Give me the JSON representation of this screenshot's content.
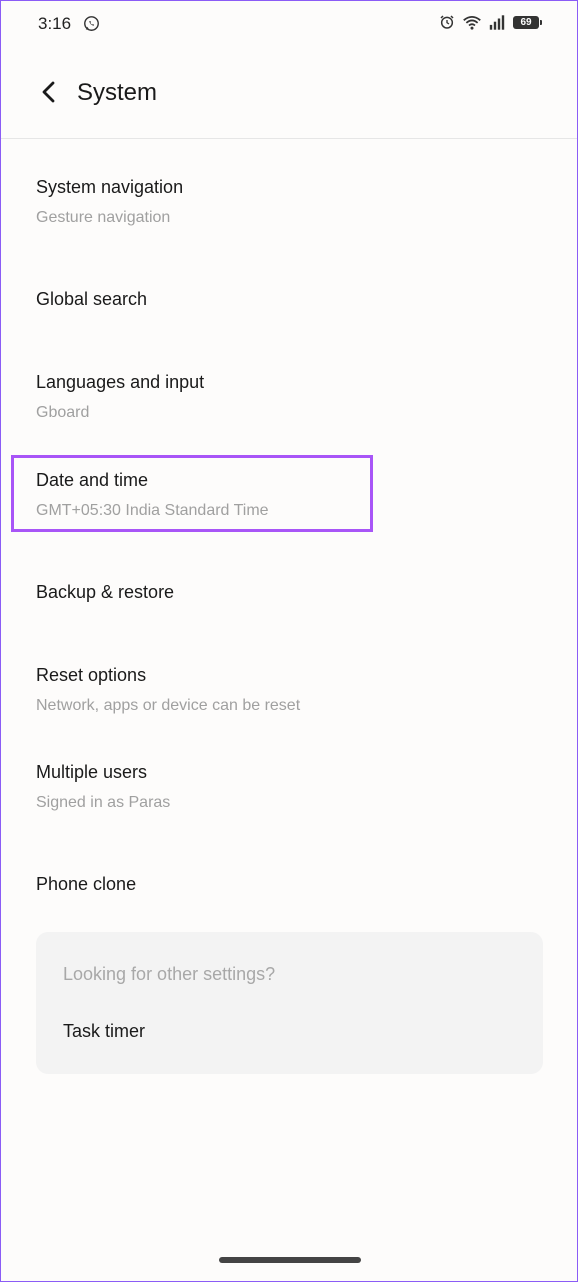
{
  "status_bar": {
    "time": "3:16",
    "battery": "69"
  },
  "header": {
    "title": "System"
  },
  "items": [
    {
      "label": "System navigation",
      "sub": "Gesture navigation"
    },
    {
      "label": "Global search"
    },
    {
      "label": "Languages and input",
      "sub": "Gboard"
    },
    {
      "label": "Date and time",
      "sub": "GMT+05:30 India Standard Time"
    },
    {
      "label": "Backup & restore"
    },
    {
      "label": "Reset options",
      "sub": "Network, apps or device can be reset"
    },
    {
      "label": "Multiple users",
      "sub": "Signed in as Paras"
    },
    {
      "label": "Phone clone"
    }
  ],
  "suggestions": {
    "title": "Looking for other settings?",
    "items": [
      "Task timer"
    ]
  },
  "colors": {
    "highlight": "#a855f7",
    "secondary_text": "#a0a0a0"
  }
}
